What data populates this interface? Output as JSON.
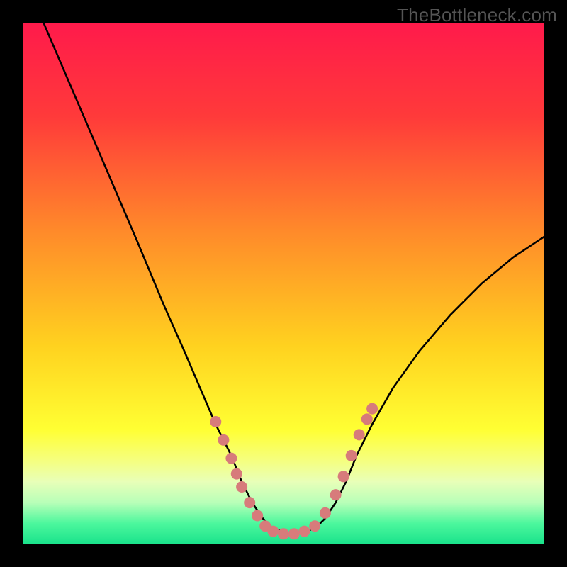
{
  "watermark": "TheBottleneck.com",
  "chart_data": {
    "type": "line",
    "title": "",
    "xlabel": "",
    "ylabel": "",
    "xlim": [
      0,
      100
    ],
    "ylim": [
      0,
      100
    ],
    "gradient_stops": [
      {
        "offset": 0,
        "color": "#ff1a4b"
      },
      {
        "offset": 18,
        "color": "#ff3a3a"
      },
      {
        "offset": 40,
        "color": "#ff8a2a"
      },
      {
        "offset": 62,
        "color": "#ffd21f"
      },
      {
        "offset": 78,
        "color": "#ffff33"
      },
      {
        "offset": 84,
        "color": "#f5ff80"
      },
      {
        "offset": 88,
        "color": "#e8ffb8"
      },
      {
        "offset": 92,
        "color": "#b8ffb8"
      },
      {
        "offset": 96,
        "color": "#4cf79d"
      },
      {
        "offset": 100,
        "color": "#19e28b"
      }
    ],
    "series": [
      {
        "name": "bottleneck-curve",
        "x": [
          4,
          10,
          16,
          22,
          27,
          31,
          34,
          37,
          40,
          42,
          44,
          46,
          48,
          52,
          56,
          58,
          60,
          62,
          64,
          67,
          71,
          76,
          82,
          88,
          94,
          100
        ],
        "y": [
          100,
          86,
          72,
          58,
          46,
          37,
          30,
          23,
          17,
          12,
          8,
          5,
          3,
          2,
          3,
          5,
          8,
          12,
          17,
          23,
          30,
          37,
          44,
          50,
          55,
          59
        ]
      }
    ],
    "dots": {
      "name": "highlight-dots",
      "color": "#d77b7b",
      "radius": 8,
      "points": [
        {
          "x": 37.0,
          "y": 23.5
        },
        {
          "x": 38.5,
          "y": 20.0
        },
        {
          "x": 40.0,
          "y": 16.5
        },
        {
          "x": 41.0,
          "y": 13.5
        },
        {
          "x": 42.0,
          "y": 11.0
        },
        {
          "x": 43.5,
          "y": 8.0
        },
        {
          "x": 45.0,
          "y": 5.5
        },
        {
          "x": 46.5,
          "y": 3.5
        },
        {
          "x": 48.0,
          "y": 2.5
        },
        {
          "x": 50.0,
          "y": 2.0
        },
        {
          "x": 52.0,
          "y": 2.0
        },
        {
          "x": 54.0,
          "y": 2.5
        },
        {
          "x": 56.0,
          "y": 3.5
        },
        {
          "x": 58.0,
          "y": 6.0
        },
        {
          "x": 60.0,
          "y": 9.5
        },
        {
          "x": 61.5,
          "y": 13.0
        },
        {
          "x": 63.0,
          "y": 17.0
        },
        {
          "x": 64.5,
          "y": 21.0
        },
        {
          "x": 66.0,
          "y": 24.0
        },
        {
          "x": 67.0,
          "y": 26.0
        }
      ]
    }
  }
}
